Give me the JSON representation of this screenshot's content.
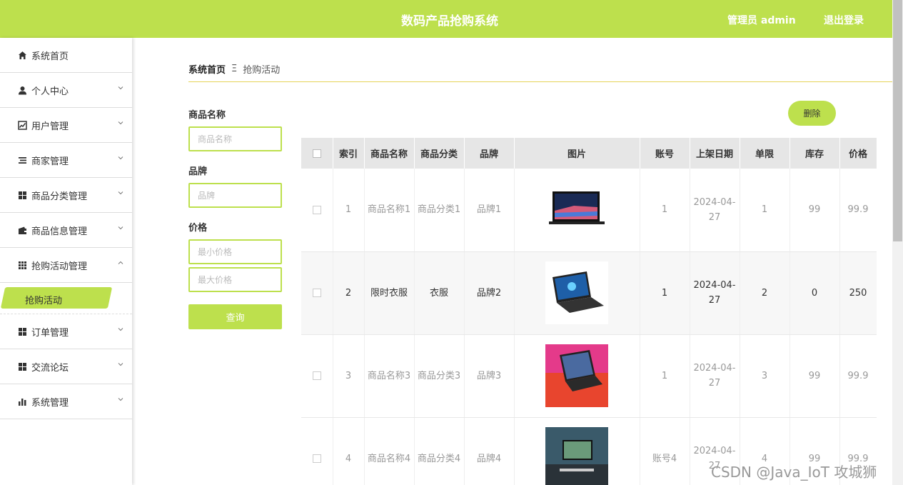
{
  "header": {
    "title": "数码产品抢购系统",
    "admin": "管理员 admin",
    "logout": "退出登录"
  },
  "sidebar": {
    "items": [
      {
        "label": "系统首页",
        "icon": "home-icon"
      },
      {
        "label": "个人中心",
        "icon": "user-icon"
      },
      {
        "label": "用户管理",
        "icon": "chart-icon"
      },
      {
        "label": "商家管理",
        "icon": "list-icon"
      },
      {
        "label": "商品分类管理",
        "icon": "grid-icon"
      },
      {
        "label": "商品信息管理",
        "icon": "wallet-icon"
      },
      {
        "label": "抢购活动管理",
        "icon": "apps-icon"
      },
      {
        "label": "订单管理",
        "icon": "grid-icon"
      },
      {
        "label": "交流论坛",
        "icon": "grid-icon"
      },
      {
        "label": "系统管理",
        "icon": "bar-chart-icon"
      }
    ],
    "active_sub": "抢购活动"
  },
  "breadcrumb": {
    "home": "系统首页",
    "sep": "Ξ",
    "current": "抢购活动"
  },
  "filters": {
    "name_label": "商品名称",
    "name_placeholder": "商品名称",
    "brand_label": "品牌",
    "brand_placeholder": "品牌",
    "price_label": "价格",
    "min_placeholder": "最小价格",
    "max_placeholder": "最大价格",
    "query": "查询"
  },
  "delete_label": "删除",
  "table": {
    "headers": [
      "索引",
      "商品名称",
      "商品分类",
      "品牌",
      "图片",
      "账号",
      "上架日期",
      "单限",
      "库存",
      "价格"
    ],
    "rows": [
      {
        "index": "1",
        "name": "商品名称1",
        "category": "商品分类1",
        "brand": "品牌1",
        "account": "1",
        "date": "2024-04-27",
        "limit": "1",
        "stock": "99",
        "price": "99.9"
      },
      {
        "index": "2",
        "name": "限时衣服",
        "category": "衣服",
        "brand": "品牌2",
        "account": "1",
        "date": "2024-04-27",
        "limit": "2",
        "stock": "0",
        "price": "250"
      },
      {
        "index": "3",
        "name": "商品名称3",
        "category": "商品分类3",
        "brand": "品牌3",
        "account": "1",
        "date": "2024-04-27",
        "limit": "3",
        "stock": "99",
        "price": "99.9"
      },
      {
        "index": "4",
        "name": "商品名称4",
        "category": "商品分类4",
        "brand": "品牌4",
        "account": "账号4",
        "date": "2024-04-27",
        "limit": "4",
        "stock": "99",
        "price": "99.9"
      }
    ]
  },
  "watermark": "CSDN @Java_IoT 攻城狮"
}
